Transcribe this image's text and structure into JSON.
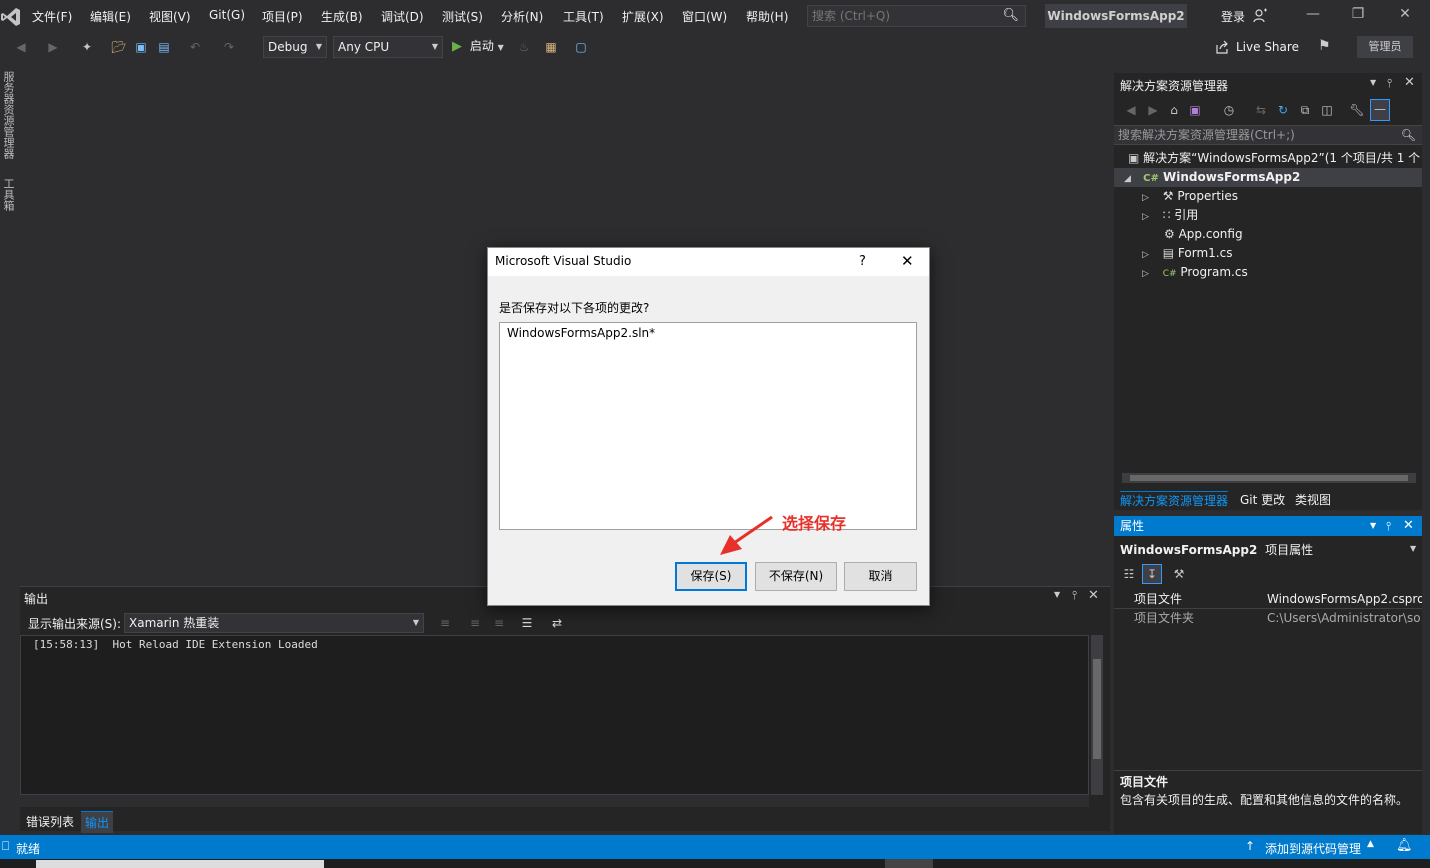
{
  "menubar": {
    "items": [
      "文件(F)",
      "编辑(E)",
      "视图(V)",
      "Git(G)",
      "项目(P)",
      "生成(B)",
      "调试(D)",
      "测试(S)",
      "分析(N)",
      "工具(T)",
      "扩展(X)",
      "窗口(W)",
      "帮助(H)"
    ],
    "search_placeholder": "搜索 (Ctrl+Q)",
    "window_title": "WindowsFormsApp2",
    "login": "登录"
  },
  "toolbar": {
    "config": "Debug",
    "platform": "Any CPU",
    "start": "启动",
    "live_share": "Live Share",
    "admin": "管理员"
  },
  "left_strip": {
    "server_explorer": "服务器资源管理器",
    "toolbox": "工具箱"
  },
  "output": {
    "title": "输出",
    "source_label": "显示输出来源(S):",
    "source_value": "Xamarin 热重装",
    "log_line": "[15:58:13]  Hot Reload IDE Extension Loaded",
    "tabs": [
      "错误列表",
      "输出"
    ]
  },
  "solution_explorer": {
    "title": "解决方案资源管理器",
    "search_placeholder": "搜索解决方案资源管理器(Ctrl+;)",
    "solution_line": "解决方案“WindowsFormsApp2”(1 个项目/共 1 个",
    "project": "WindowsFormsApp2",
    "items": [
      "Properties",
      "引用",
      "App.config",
      "Form1.cs",
      "Program.cs"
    ],
    "tabs": [
      "解决方案资源管理器",
      "Git 更改",
      "类视图"
    ]
  },
  "properties": {
    "title": "属性",
    "subject": "WindowsFormsApp2",
    "subject_type": "项目属性",
    "rows": [
      {
        "name": "项目文件",
        "value": "WindowsFormsApp2.cspro"
      },
      {
        "name": "项目文件夹",
        "value": "C:\\Users\\Administrator\\so"
      }
    ],
    "desc_title": "项目文件",
    "desc_text": "包含有关项目的生成、配置和其他信息的文件的名称。"
  },
  "statusbar": {
    "ready": "就绪",
    "source_control": "添加到源代码管理"
  },
  "dialog": {
    "title": "Microsoft Visual Studio",
    "help": "?",
    "question": "是否保存对以下各项的更改?",
    "items": [
      "WindowsFormsApp2.sln*"
    ],
    "save": "保存(S)",
    "dont_save": "不保存(N)",
    "cancel": "取消"
  },
  "annotation": {
    "text": "选择保存",
    "color": "#e8302a"
  },
  "colors": {
    "accent": "#007acc",
    "background": "#2d2d30",
    "panel": "#252526"
  }
}
